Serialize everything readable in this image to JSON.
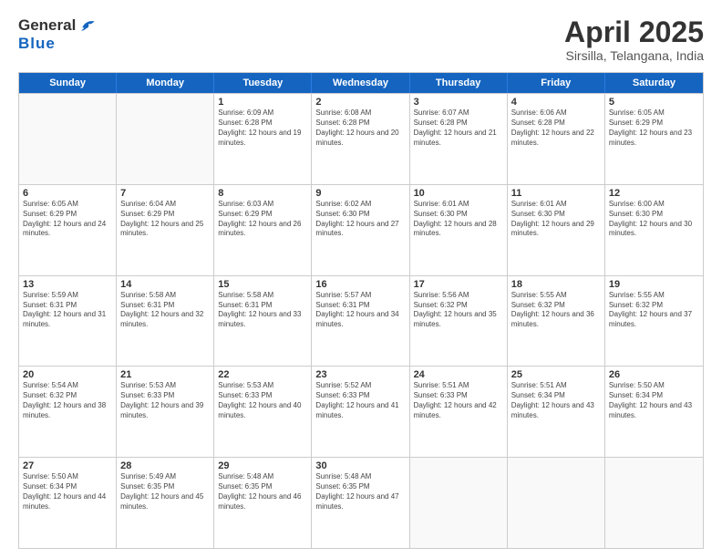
{
  "logo": {
    "general": "General",
    "blue": "Blue"
  },
  "title": "April 2025",
  "subtitle": "Sirsilla, Telangana, India",
  "header_days": [
    "Sunday",
    "Monday",
    "Tuesday",
    "Wednesday",
    "Thursday",
    "Friday",
    "Saturday"
  ],
  "weeks": [
    [
      {
        "day": "",
        "sunrise": "",
        "sunset": "",
        "daylight": ""
      },
      {
        "day": "",
        "sunrise": "",
        "sunset": "",
        "daylight": ""
      },
      {
        "day": "1",
        "sunrise": "Sunrise: 6:09 AM",
        "sunset": "Sunset: 6:28 PM",
        "daylight": "Daylight: 12 hours and 19 minutes."
      },
      {
        "day": "2",
        "sunrise": "Sunrise: 6:08 AM",
        "sunset": "Sunset: 6:28 PM",
        "daylight": "Daylight: 12 hours and 20 minutes."
      },
      {
        "day": "3",
        "sunrise": "Sunrise: 6:07 AM",
        "sunset": "Sunset: 6:28 PM",
        "daylight": "Daylight: 12 hours and 21 minutes."
      },
      {
        "day": "4",
        "sunrise": "Sunrise: 6:06 AM",
        "sunset": "Sunset: 6:28 PM",
        "daylight": "Daylight: 12 hours and 22 minutes."
      },
      {
        "day": "5",
        "sunrise": "Sunrise: 6:05 AM",
        "sunset": "Sunset: 6:29 PM",
        "daylight": "Daylight: 12 hours and 23 minutes."
      }
    ],
    [
      {
        "day": "6",
        "sunrise": "Sunrise: 6:05 AM",
        "sunset": "Sunset: 6:29 PM",
        "daylight": "Daylight: 12 hours and 24 minutes."
      },
      {
        "day": "7",
        "sunrise": "Sunrise: 6:04 AM",
        "sunset": "Sunset: 6:29 PM",
        "daylight": "Daylight: 12 hours and 25 minutes."
      },
      {
        "day": "8",
        "sunrise": "Sunrise: 6:03 AM",
        "sunset": "Sunset: 6:29 PM",
        "daylight": "Daylight: 12 hours and 26 minutes."
      },
      {
        "day": "9",
        "sunrise": "Sunrise: 6:02 AM",
        "sunset": "Sunset: 6:30 PM",
        "daylight": "Daylight: 12 hours and 27 minutes."
      },
      {
        "day": "10",
        "sunrise": "Sunrise: 6:01 AM",
        "sunset": "Sunset: 6:30 PM",
        "daylight": "Daylight: 12 hours and 28 minutes."
      },
      {
        "day": "11",
        "sunrise": "Sunrise: 6:01 AM",
        "sunset": "Sunset: 6:30 PM",
        "daylight": "Daylight: 12 hours and 29 minutes."
      },
      {
        "day": "12",
        "sunrise": "Sunrise: 6:00 AM",
        "sunset": "Sunset: 6:30 PM",
        "daylight": "Daylight: 12 hours and 30 minutes."
      }
    ],
    [
      {
        "day": "13",
        "sunrise": "Sunrise: 5:59 AM",
        "sunset": "Sunset: 6:31 PM",
        "daylight": "Daylight: 12 hours and 31 minutes."
      },
      {
        "day": "14",
        "sunrise": "Sunrise: 5:58 AM",
        "sunset": "Sunset: 6:31 PM",
        "daylight": "Daylight: 12 hours and 32 minutes."
      },
      {
        "day": "15",
        "sunrise": "Sunrise: 5:58 AM",
        "sunset": "Sunset: 6:31 PM",
        "daylight": "Daylight: 12 hours and 33 minutes."
      },
      {
        "day": "16",
        "sunrise": "Sunrise: 5:57 AM",
        "sunset": "Sunset: 6:31 PM",
        "daylight": "Daylight: 12 hours and 34 minutes."
      },
      {
        "day": "17",
        "sunrise": "Sunrise: 5:56 AM",
        "sunset": "Sunset: 6:32 PM",
        "daylight": "Daylight: 12 hours and 35 minutes."
      },
      {
        "day": "18",
        "sunrise": "Sunrise: 5:55 AM",
        "sunset": "Sunset: 6:32 PM",
        "daylight": "Daylight: 12 hours and 36 minutes."
      },
      {
        "day": "19",
        "sunrise": "Sunrise: 5:55 AM",
        "sunset": "Sunset: 6:32 PM",
        "daylight": "Daylight: 12 hours and 37 minutes."
      }
    ],
    [
      {
        "day": "20",
        "sunrise": "Sunrise: 5:54 AM",
        "sunset": "Sunset: 6:32 PM",
        "daylight": "Daylight: 12 hours and 38 minutes."
      },
      {
        "day": "21",
        "sunrise": "Sunrise: 5:53 AM",
        "sunset": "Sunset: 6:33 PM",
        "daylight": "Daylight: 12 hours and 39 minutes."
      },
      {
        "day": "22",
        "sunrise": "Sunrise: 5:53 AM",
        "sunset": "Sunset: 6:33 PM",
        "daylight": "Daylight: 12 hours and 40 minutes."
      },
      {
        "day": "23",
        "sunrise": "Sunrise: 5:52 AM",
        "sunset": "Sunset: 6:33 PM",
        "daylight": "Daylight: 12 hours and 41 minutes."
      },
      {
        "day": "24",
        "sunrise": "Sunrise: 5:51 AM",
        "sunset": "Sunset: 6:33 PM",
        "daylight": "Daylight: 12 hours and 42 minutes."
      },
      {
        "day": "25",
        "sunrise": "Sunrise: 5:51 AM",
        "sunset": "Sunset: 6:34 PM",
        "daylight": "Daylight: 12 hours and 43 minutes."
      },
      {
        "day": "26",
        "sunrise": "Sunrise: 5:50 AM",
        "sunset": "Sunset: 6:34 PM",
        "daylight": "Daylight: 12 hours and 43 minutes."
      }
    ],
    [
      {
        "day": "27",
        "sunrise": "Sunrise: 5:50 AM",
        "sunset": "Sunset: 6:34 PM",
        "daylight": "Daylight: 12 hours and 44 minutes."
      },
      {
        "day": "28",
        "sunrise": "Sunrise: 5:49 AM",
        "sunset": "Sunset: 6:35 PM",
        "daylight": "Daylight: 12 hours and 45 minutes."
      },
      {
        "day": "29",
        "sunrise": "Sunrise: 5:48 AM",
        "sunset": "Sunset: 6:35 PM",
        "daylight": "Daylight: 12 hours and 46 minutes."
      },
      {
        "day": "30",
        "sunrise": "Sunrise: 5:48 AM",
        "sunset": "Sunset: 6:35 PM",
        "daylight": "Daylight: 12 hours and 47 minutes."
      },
      {
        "day": "",
        "sunrise": "",
        "sunset": "",
        "daylight": ""
      },
      {
        "day": "",
        "sunrise": "",
        "sunset": "",
        "daylight": ""
      },
      {
        "day": "",
        "sunrise": "",
        "sunset": "",
        "daylight": ""
      }
    ]
  ]
}
